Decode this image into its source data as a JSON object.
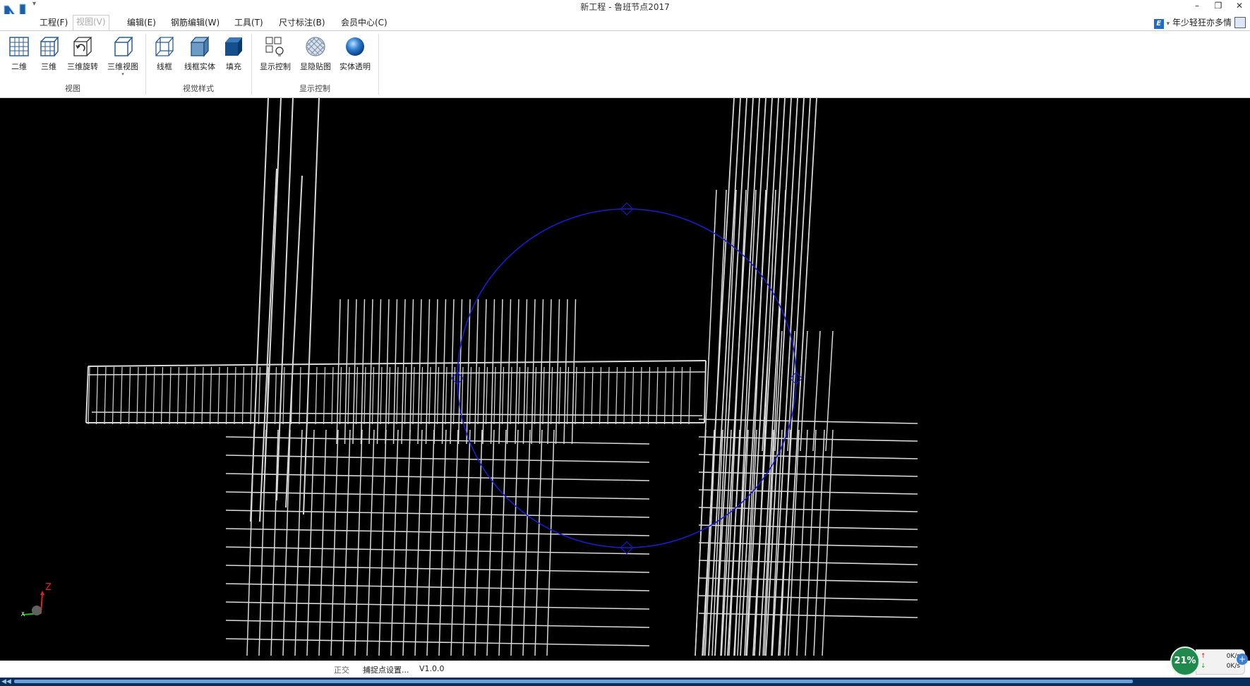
{
  "window": {
    "title": "新工程 - 鲁班节点2017",
    "minimize_glyph": "–",
    "restore_glyph": "❐",
    "close_glyph": "✕"
  },
  "menu": {
    "tabs": [
      "工程(F)",
      "视图(V)",
      "编辑(E)",
      "钢筋编辑(W)",
      "工具(T)",
      "尺寸标注(B)",
      "会员中心(C)"
    ],
    "active_tab": "视图(V)"
  },
  "ribbon": {
    "groups": [
      {
        "label": "视图",
        "buttons": [
          "二维",
          "三维",
          "三维旋转",
          "三维视图"
        ]
      },
      {
        "label": "视觉样式",
        "buttons": [
          "线框",
          "线框实体",
          "填充"
        ]
      },
      {
        "label": "显示控制",
        "buttons": [
          "显示控制",
          "显隐贴图",
          "实体透明"
        ]
      }
    ]
  },
  "user": {
    "name": "年少轻狂亦多情",
    "badge": "E"
  },
  "viewport": {
    "axis_label": "Z",
    "accent_circle_color": "#1b1bd0",
    "background": "#000000",
    "rebar_color": "#d8d8d8"
  },
  "status": {
    "ortho": "正交",
    "snap": "捕捉点设置...",
    "version": "V1.0.0"
  },
  "net": {
    "percent": "21%",
    "up": "0K/s",
    "down": "0K/s",
    "up_arrow": "↑",
    "down_arrow": "↓"
  }
}
